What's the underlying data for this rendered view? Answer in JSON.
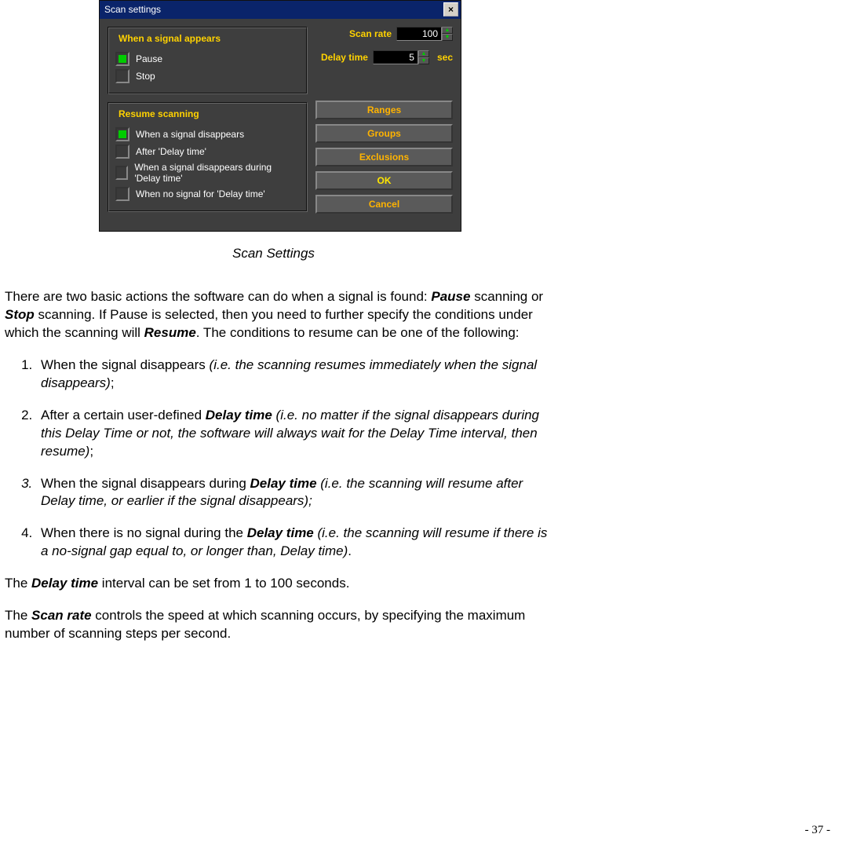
{
  "dialog": {
    "title": "Scan settings",
    "close_symbol": "×",
    "group1": {
      "title": "When a signal appears",
      "opt_pause": "Pause",
      "opt_stop": "Stop"
    },
    "group2": {
      "title": "Resume scanning",
      "opt_a": "When a signal disappears",
      "opt_b": "After 'Delay time'",
      "opt_c": "When a signal disappears during 'Delay time'",
      "opt_d": "When no signal for 'Delay time'"
    },
    "scanrate_label": "Scan rate",
    "scanrate_value": "100",
    "delay_label": "Delay time",
    "delay_value": "5",
    "sec_unit": "sec",
    "btn_ranges": "Ranges",
    "btn_groups": "Groups",
    "btn_exclusions": "Exclusions",
    "btn_ok": "OK",
    "btn_cancel": "Cancel"
  },
  "caption": "Scan Settings",
  "text": {
    "intro_a": "There are two basic actions the software can do when a signal is found: ",
    "intro_pause": "Pause",
    "intro_mid": " scanning or ",
    "intro_stop": "Stop",
    "intro_b": " scanning. If Pause is selected, then you need to further specify the conditions under which the scanning will ",
    "intro_resume": "Resume",
    "intro_c": ". The conditions to resume can be one of the following:",
    "li1_a": "When the signal disappears ",
    "li1_b": "(i.e. the scanning resumes immediately when the signal disappears)",
    "li1_c": ";",
    "li2_a": "After a certain user-defined ",
    "li2_dt": "Delay time",
    "li2_b": " (i.e. no matter if the signal disappears during this Delay Time or not, the software will always wait for the Delay Time interval, then resume)",
    "li2_c": ";",
    "li3_a": "When the signal disappears during ",
    "li3_dt": "Delay time",
    "li3_b": " (i.e. the scanning will resume after Delay time, or earlier if the signal disappears);",
    "li4_a": "When there is no signal during the ",
    "li4_dt": "Delay time",
    "li4_b": " (i.e. the scanning will resume if there is a no-signal gap equal to, or longer than, Delay time)",
    "li4_c": ".",
    "p_delay_a": "The ",
    "p_delay_dt": "Delay time",
    "p_delay_b": " interval can be set from 1 to 100 seconds.",
    "p_scan_a": "The ",
    "p_scan_sr": "Scan rate",
    "p_scan_b": " controls the speed at which scanning occurs, by specifying the maximum number of scanning steps per second."
  },
  "page_number": "- 37 -"
}
